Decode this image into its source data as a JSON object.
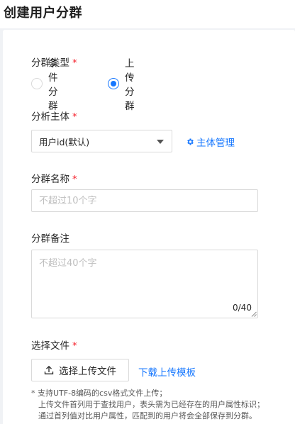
{
  "page": {
    "title": "创建用户分群"
  },
  "form": {
    "type_field": {
      "label": "分群类型",
      "required_mark": "*",
      "options": [
        {
          "label": "条件分群",
          "selected": false
        },
        {
          "label": "上传分群",
          "selected": true
        }
      ]
    },
    "entity_field": {
      "label": "分析主体",
      "required_mark": "*",
      "value": "用户id(默认)",
      "manage_link": "主体管理",
      "manage_icon": "gear-icon"
    },
    "name_field": {
      "label": "分群名称",
      "required_mark": "*",
      "placeholder": "不超过10个字",
      "value": ""
    },
    "remark_field": {
      "label": "分群备注",
      "placeholder": "不超过40个字",
      "value": "",
      "counter": "0/40"
    },
    "file_field": {
      "label": "选择文件",
      "required_mark": "*",
      "upload_button": "选择上传文件",
      "upload_icon": "upload-icon",
      "template_link": "下载上传模板",
      "hints": [
        "* 支持UTF-8编码的csv格式文件上传；",
        "上传文件首列用于查找用户，表头需为已经存在的用户属性标识；",
        "通过首列值对比用户属性，匹配到的用户将会全部保存到分群。"
      ]
    }
  },
  "colors": {
    "accent": "#1677ff",
    "required": "#f5222d",
    "border": "#d9d9d9"
  }
}
